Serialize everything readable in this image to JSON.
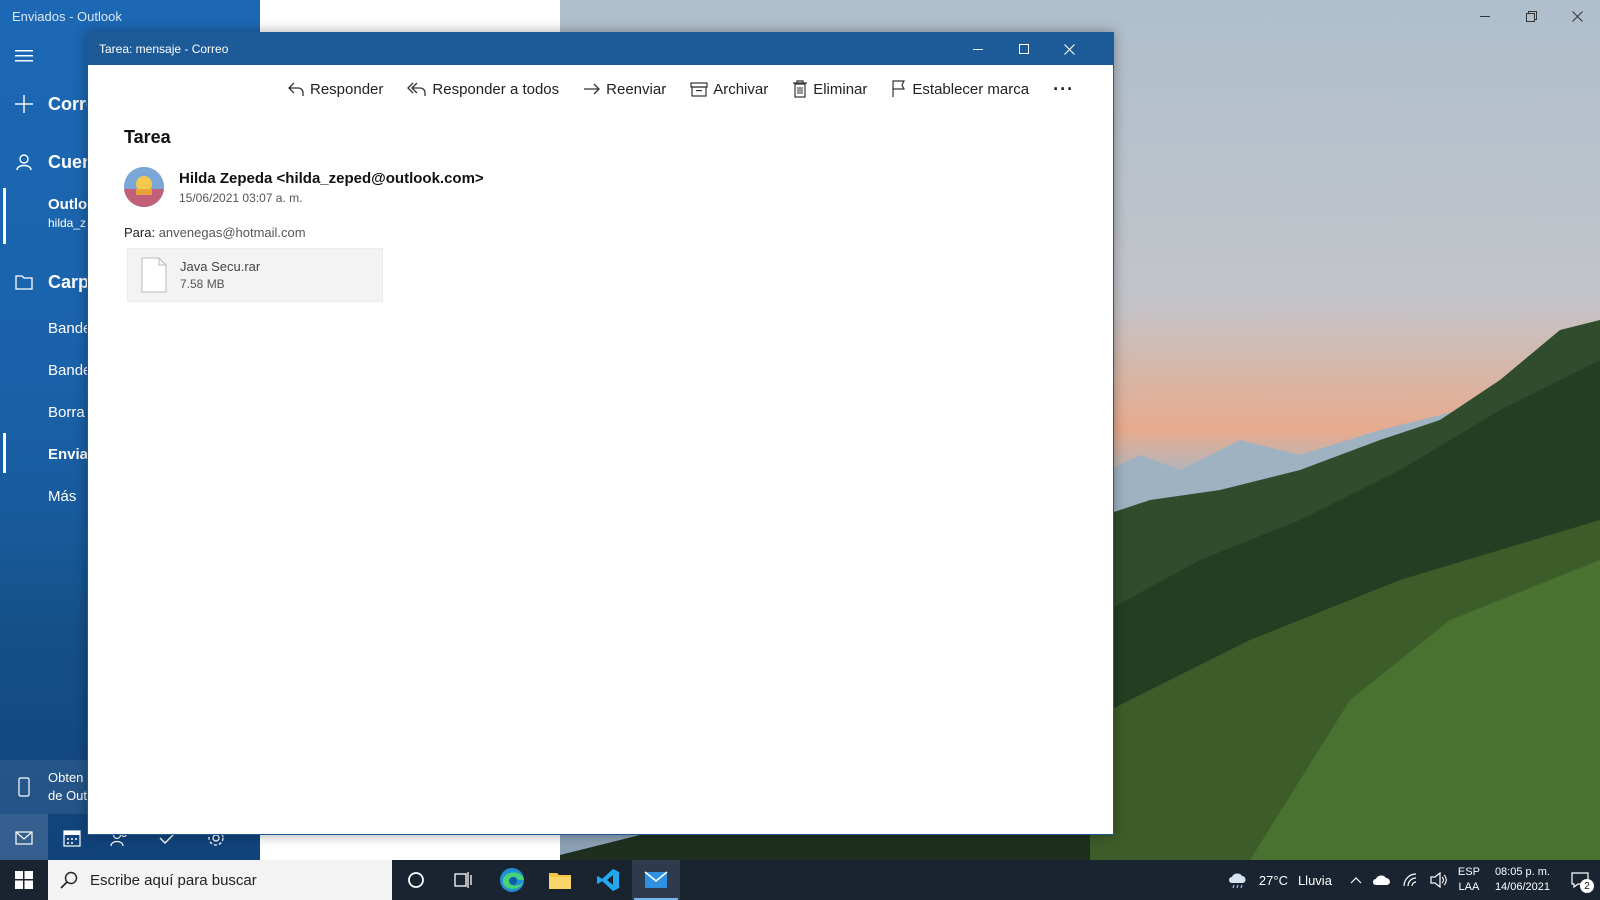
{
  "outlook": {
    "window_title": "Enviados - Outlook",
    "sidebar": {
      "new_mail": "Corre",
      "accounts": "Cuen",
      "account_name": "Outlo",
      "account_email": "hilda_z",
      "folders": "Carpe",
      "folder_items": [
        "Bande",
        "Bande",
        "Borra",
        "Envia",
        "Más"
      ],
      "get_app_line1": "Obten",
      "get_app_line2": "de Out"
    }
  },
  "message_window": {
    "title": "Tarea: mensaje - Correo",
    "toolbar": {
      "reply": "Responder",
      "reply_all": "Responder a todos",
      "forward": "Reenviar",
      "archive": "Archivar",
      "delete": "Eliminar",
      "flag": "Establecer marca",
      "more": "···"
    },
    "subject": "Tarea",
    "sender": "Hilda Zepeda <hilda_zeped@outlook.com>",
    "date": "15/06/2021 03:07 a. m.",
    "to_label": "Para:",
    "to_value": "anvenegas@hotmail.com",
    "attachment": {
      "name": "Java Secu.rar",
      "size": "7.58 MB"
    }
  },
  "taskbar": {
    "search_placeholder": "Escribe aquí para buscar",
    "weather_temp": "27°C",
    "weather_desc": "Lluvia",
    "lang_top": "ESP",
    "lang_bottom": "LAA",
    "time": "08:05 p. m.",
    "date": "14/06/2021",
    "notification_count": "2"
  },
  "colors": {
    "outlook_blue": "#1c68b4",
    "titlebar_blue": "#1c5a98",
    "taskbar": "#1a2330"
  }
}
